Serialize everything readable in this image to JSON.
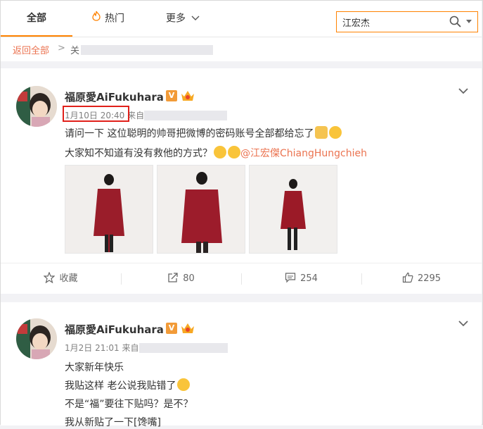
{
  "tabs": {
    "all": "全部",
    "hot": "热门",
    "more": "更多"
  },
  "search": {
    "value": "江宏杰"
  },
  "breadcrumb": {
    "back": "返回全部",
    "separator": ">",
    "current": "关"
  },
  "posts": [
    {
      "author": "福原愛AiFukuhara",
      "verified": "V",
      "time": "1月10日 20:40",
      "source_prefix": "来自",
      "lines": [
        "请问一下 这位聪明的帅哥把微博的密码账号全部都给忘了",
        "大家知不知道有没有救他的方式？"
      ],
      "mention": "@江宏傑ChiangHungchieh",
      "actions": {
        "favorite": "收藏",
        "repost": "80",
        "comment": "254",
        "like": "2295"
      }
    },
    {
      "author": "福原愛AiFukuhara",
      "verified": "V",
      "time": "1月2日 21:01",
      "source_prefix": "来自",
      "lines": [
        "大家新年快乐",
        "我贴这样 老公说我贴错了",
        "不是“福”要往下贴吗？是不？",
        "我从新贴了一下[馋嘴]"
      ]
    }
  ],
  "colors": {
    "accent": "#ff8200",
    "link": "#eb7350",
    "highlight_box": "#e0201a"
  }
}
